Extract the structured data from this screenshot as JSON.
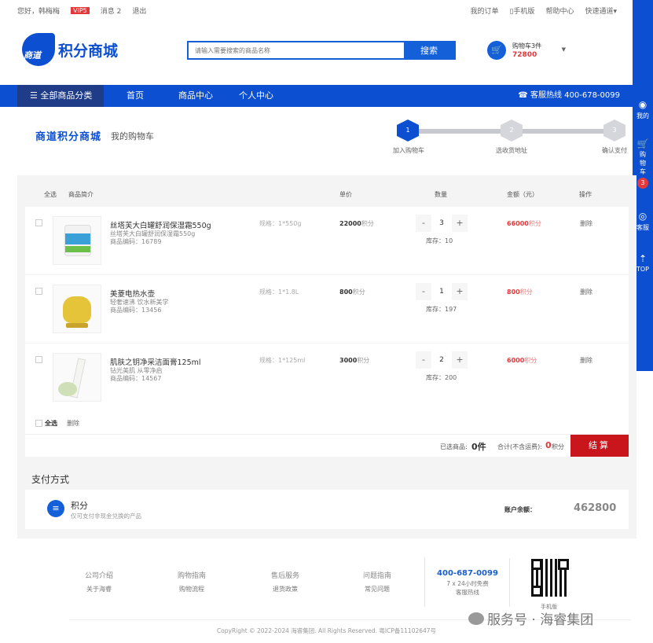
{
  "topbar": {
    "greeting": "您好，韩梅梅",
    "vip": "VIP5",
    "messages": "消息 2",
    "logout": "退出",
    "my_orders": "我的订单",
    "mobile": "手机版",
    "help": "帮助中心",
    "quick": "快速通道"
  },
  "header": {
    "logo_mark": "商道",
    "logo_text": "积分商城",
    "search_placeholder": "请输入需要搜索的商品名称",
    "search_button": "搜索",
    "cart_label": "购物车3件",
    "cart_points": "72800"
  },
  "nav": {
    "all": "全部商品分类",
    "items": [
      "首页",
      "商品中心",
      "个人中心"
    ],
    "hotline": "客服热线 400-678-0099"
  },
  "sidebar": {
    "mine": "我的",
    "cart": "购物车",
    "cart_count": "3",
    "service": "客服",
    "top": "TOP"
  },
  "crumb": {
    "brand": "商道积分商城",
    "page": "我的购物车"
  },
  "steps": [
    {
      "num": "1",
      "label": "加入购物车"
    },
    {
      "num": "2",
      "label": "选收货地址"
    },
    {
      "num": "3",
      "label": "确认支付"
    }
  ],
  "table": {
    "headers": {
      "all": "全选",
      "intro": "商品简介",
      "price": "单价",
      "qty": "数量",
      "amount": "金额（元）",
      "op": "操作"
    },
    "rows": [
      {
        "name": "丝塔芙大白罐舒润保湿霜550g",
        "sub": "丝塔芙大白罐舒润保湿霜550g",
        "code": "商品编码：16789",
        "spec": "规格：1*550g",
        "price": "22000",
        "unit": "积分",
        "qty": "3",
        "stock": "库存：10",
        "amount": "66000",
        "delete": "删除"
      },
      {
        "name": "美菱电热水壶",
        "sub": "轻奢速沸 饮水新美学",
        "code": "商品编码：13456",
        "spec": "规格：1*1.8L",
        "price": "800",
        "unit": "积分",
        "qty": "1",
        "stock": "库存：197",
        "amount": "800",
        "delete": "删除"
      },
      {
        "name": "肌肤之钥净采洁面膏125ml",
        "sub": "钻光美肌 从零净启",
        "code": "商品编码：14567",
        "spec": "规格：1*125ml",
        "price": "3000",
        "unit": "积分",
        "qty": "2",
        "stock": "库存：200",
        "amount": "6000",
        "delete": "删除"
      }
    ],
    "minus": "-",
    "plus": "+"
  },
  "summary": {
    "select_all": "全选",
    "delete": "删除",
    "selected_label": "已选商品:",
    "selected_count": "0件",
    "total_label": "合计(不含运费):",
    "total_value": "0",
    "total_unit": "积分",
    "checkout": "结算"
  },
  "payment": {
    "title": "支付方式",
    "method": "积分",
    "method_desc": "仅可支付非现金兑换的产品",
    "balance_label": "账户余额：",
    "balance": "462800"
  },
  "footer": {
    "cols": [
      {
        "title": "公司介绍",
        "link": "关于海睿"
      },
      {
        "title": "购物指南",
        "link": "购物流程"
      },
      {
        "title": "售后服务",
        "link": "退货政策"
      },
      {
        "title": "问题指南",
        "link": "常见问题"
      }
    ],
    "phone": "400-687-0099",
    "phone_desc": "7 x 24小时免费",
    "phone_label": "客服热线",
    "qr_label": "手机版",
    "copyright": "CopyRight © 2022-2024 海睿集团. All Rights Reserved. 粤ICP备11102647号"
  },
  "watermark": "服务号 · 海睿集团",
  "colors": {
    "brand_blue": "#0d4fd1",
    "red": "#e4393c",
    "checkout_red": "#c9161c"
  }
}
